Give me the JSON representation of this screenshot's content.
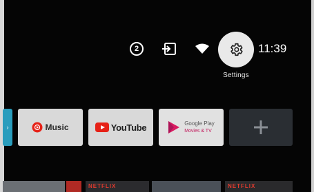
{
  "status_bar": {
    "notification_count": "2",
    "settings_label": "Settings",
    "time": "11:39"
  },
  "apps": [
    {
      "label": "Music"
    },
    {
      "label": "YouTube"
    },
    {
      "label_line1": "Google Play",
      "label_line2": "Movies & TV"
    }
  ],
  "bottom_row": {
    "thumb_labels": [
      "NETFLIX",
      "NETFLIX"
    ]
  },
  "colors": {
    "settings_focus": "#e9e9e9",
    "youtube_red": "#e62117",
    "netflix_red": "#e23b2e",
    "add_tile": "#2a2e33"
  }
}
